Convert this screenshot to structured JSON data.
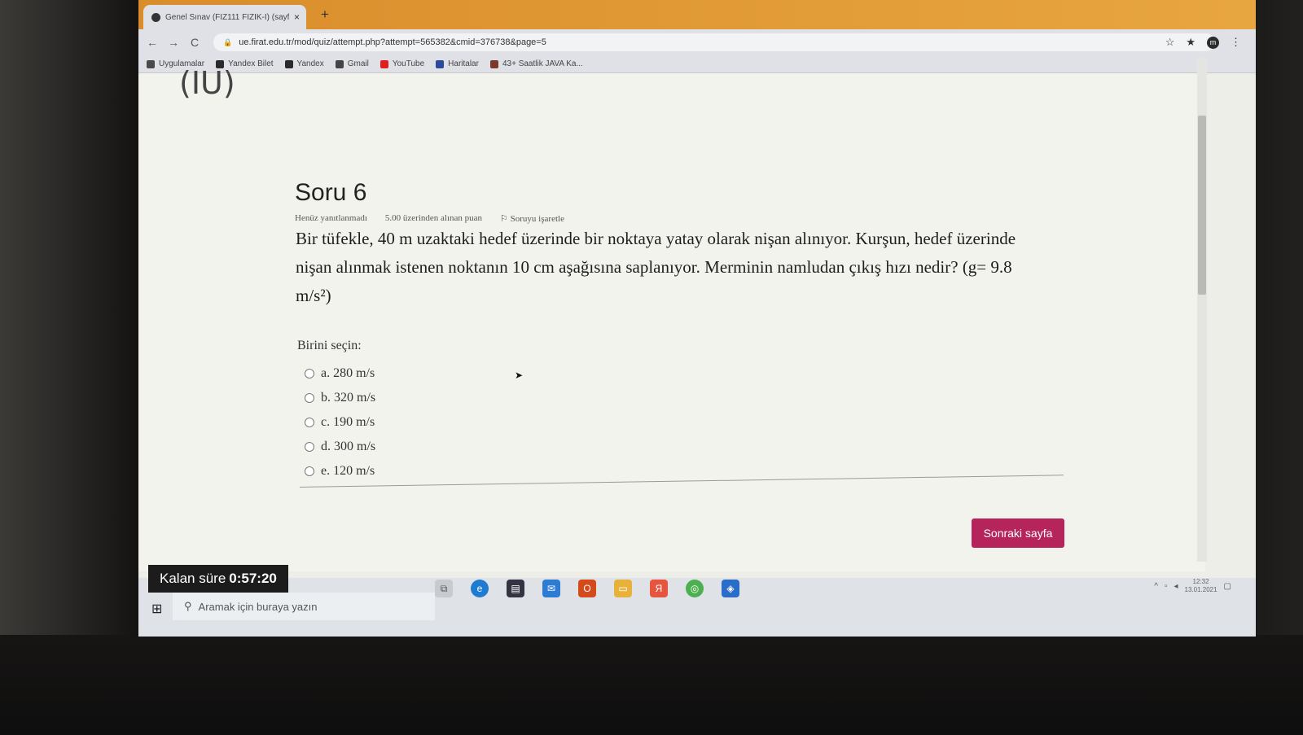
{
  "browser": {
    "tab_title": "Genel Sınav (FIZ111 FIZIK-I) (sayf",
    "tab_close": "×",
    "new_tab": "+",
    "url": "ue.firat.edu.tr/mod/quiz/attempt.php?attempt=565382&cmid=376738&page=5",
    "nav": {
      "back": "←",
      "forward": "→",
      "reload": "C"
    },
    "icons": {
      "star": "☆",
      "extensions": "★",
      "profile": "m",
      "menu": "⋮"
    },
    "bookmarks": [
      {
        "label": "Uygulamalar",
        "color": "#4a4a4a"
      },
      {
        "label": "Yandex Bilet",
        "color": "#2a2a2a"
      },
      {
        "label": "Yandex",
        "color": "#2a2a2a"
      },
      {
        "label": "Gmail",
        "color": "#444444"
      },
      {
        "label": "YouTube",
        "color": "#e02020"
      },
      {
        "label": "Haritalar",
        "color": "#2a4a9a"
      },
      {
        "label": "43+ Saatlik JAVA Ka...",
        "color": "#7a3a2a"
      }
    ]
  },
  "page": {
    "prev_label": "(IU)",
    "question_title": "Soru 6",
    "meta": {
      "status": "Henüz yanıtlanmadı",
      "points": "5.00 üzerinden alınan puan",
      "flag": "Soruyu işaretle"
    },
    "question_text": "Bir tüfekle, 40 m uzaktaki hedef üzerinde bir noktaya yatay olarak nişan alınıyor. Kurşun, hedef üzerinde nişan alınmak istenen noktanın 10 cm aşağısına saplanıyor. Merminin namludan çıkış hızı nedir? (g= 9.8 m/s²)",
    "choose_label": "Birini seçin:",
    "options": [
      {
        "label": "a. 280 m/s"
      },
      {
        "label": "b. 320 m/s"
      },
      {
        "label": "c. 190 m/s"
      },
      {
        "label": "d. 300 m/s"
      },
      {
        "label": "e. 120 m/s"
      }
    ],
    "next_button": "Sonraki sayfa",
    "timer_label": "Kalan süre",
    "timer_value": "0:57:20"
  },
  "taskbar": {
    "start_icon": "⊞",
    "search_placeholder": "Aramak için buraya yazın",
    "clock_time": "12:32",
    "clock_date": "13.01.2021"
  },
  "colors": {
    "accent": "#b5245b",
    "tab_bar": "#e8a640"
  }
}
